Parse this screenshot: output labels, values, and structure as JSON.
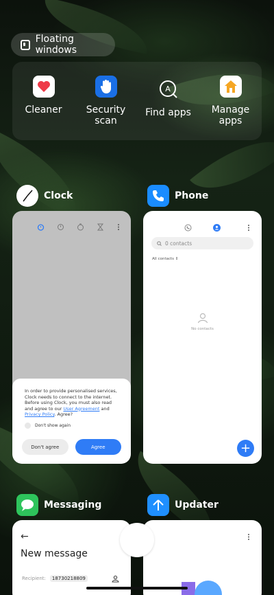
{
  "floating_windows": {
    "label": "Floating windows",
    "icon": "floating-window-icon"
  },
  "quick_actions": [
    {
      "id": "cleaner",
      "label": "Cleaner",
      "icon": "heart-icon",
      "color": "#ee3b48"
    },
    {
      "id": "security-scan",
      "label": "Security scan",
      "icon": "raised-hand-icon",
      "color": "#1a6fe6"
    },
    {
      "id": "find-apps",
      "label": "Find apps",
      "icon": "search-apps-icon",
      "color": "#ffffff"
    },
    {
      "id": "manage-apps",
      "label": "Manage apps",
      "icon": "home-icon",
      "color": "#f5a623"
    }
  ],
  "apps": {
    "clock": {
      "name": "Clock",
      "icon": "clock-icon",
      "tabs": [
        "alarm-icon",
        "world-clock-icon",
        "stopwatch-icon",
        "timer-icon",
        "more-icon"
      ],
      "dialog": {
        "text_part1": "In order to provide personalised services, Clock needs to connect to the internet. Before using Clock, you must also read and agree to our ",
        "link1": "User Agreement",
        "text_part2": " and ",
        "link2": "Privacy Policy",
        "text_part3": ". Agree?",
        "checkbox_label": "Don't show again",
        "cancel_label": "Don't agree",
        "agree_label": "Agree"
      }
    },
    "phone": {
      "name": "Phone",
      "icon": "phone-icon",
      "search_placeholder": "0 contacts",
      "filter_label": "All contacts",
      "empty_label": "No contacts"
    },
    "messaging": {
      "name": "Messaging",
      "icon": "chat-bubble-icon",
      "title": "New message",
      "recipient_label": "Recipient:",
      "recipient_value": "18730218809"
    },
    "updater": {
      "name": "Updater",
      "icon": "arrow-up-icon"
    }
  },
  "colors": {
    "accent": "#2f7cf6",
    "phone_icon": "#1a8cff",
    "messaging_icon": "#2ec45c",
    "updater_icon": "#1f8fff"
  }
}
